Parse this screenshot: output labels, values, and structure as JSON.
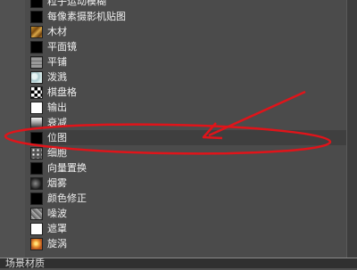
{
  "items": [
    {
      "label": "粒子运动模糊",
      "icon": "particle-motion-blur-icon"
    },
    {
      "label": "每像素摄影机贴图",
      "icon": "per-pixel-camera-map-icon"
    },
    {
      "label": "木材",
      "icon": "wood-icon"
    },
    {
      "label": "平面镜",
      "icon": "flat-mirror-icon"
    },
    {
      "label": "平铺",
      "icon": "tiles-icon"
    },
    {
      "label": "泼溅",
      "icon": "splat-icon"
    },
    {
      "label": "棋盘格",
      "icon": "checker-icon"
    },
    {
      "label": "输出",
      "icon": "output-icon"
    },
    {
      "label": "衰减",
      "icon": "falloff-icon"
    },
    {
      "label": "位图",
      "icon": "bitmap-icon"
    },
    {
      "label": "细胞",
      "icon": "cellular-icon"
    },
    {
      "label": "向量置换",
      "icon": "vector-displacement-icon"
    },
    {
      "label": "烟雾",
      "icon": "smoke-icon"
    },
    {
      "label": "颜色修正",
      "icon": "color-correction-icon"
    },
    {
      "label": "噪波",
      "icon": "noise-icon"
    },
    {
      "label": "遮罩",
      "icon": "mask-icon"
    },
    {
      "label": "旋涡",
      "icon": "swirl-icon"
    }
  ],
  "bottom": {
    "label": "场景材质"
  },
  "annotation": {
    "color": "#e0141a",
    "highlighted_item": "位图"
  }
}
